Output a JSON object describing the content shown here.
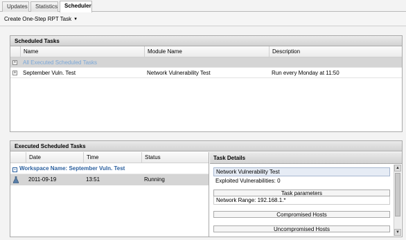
{
  "tabs": [
    "Updates",
    "Statistics",
    "Scheduler"
  ],
  "toolbar": {
    "menu_label": "Create One-Step RPT Task"
  },
  "scheduled": {
    "title": "Scheduled Tasks",
    "columns": [
      "Name",
      "Module Name",
      "Description"
    ],
    "group_row": "All Executed Scheduled Tasks",
    "rows": [
      {
        "name": "September Vuln. Test",
        "module": "Network Vulnerability Test",
        "description": "Run every Monday at 11:50"
      }
    ]
  },
  "executed": {
    "title": "Executed Scheduled Tasks",
    "columns": [
      "Date",
      "Time",
      "Status"
    ],
    "workspace": "Workspace Name: September Vuln. Test",
    "rows": [
      {
        "date": "2011-09-19",
        "time": "13:51",
        "status": "Running"
      }
    ]
  },
  "details": {
    "title": "Task Details",
    "module": "Network Vulnerability Test",
    "exploited": "Exploited Vulnerabilities: 0",
    "params_label": "Task parameters",
    "network_range": "Network Range: 192.168.1.*",
    "compromised": "Compromised Hosts",
    "uncompromised": "Uncompromised Hosts"
  },
  "icons": {
    "expand": "plus-box-icon",
    "collapse": "minus-box-icon",
    "task": "flask-icon",
    "menu": "caret-down-icon"
  }
}
